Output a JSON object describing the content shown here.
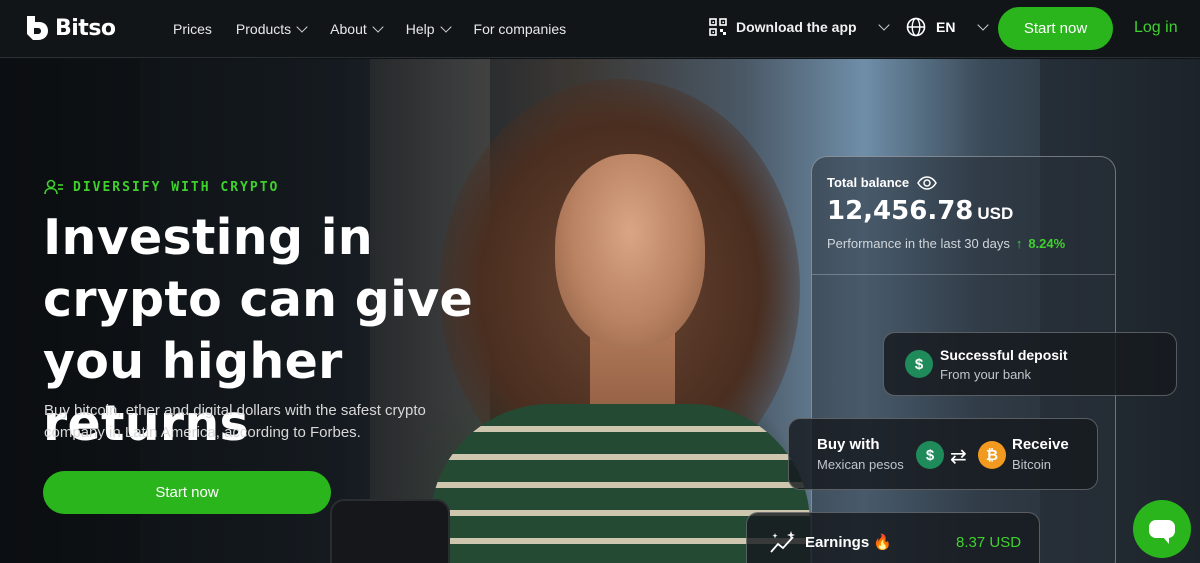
{
  "brand": {
    "name": "Bitso"
  },
  "nav": {
    "items": [
      {
        "label": "Prices",
        "dropdown": false
      },
      {
        "label": "Products",
        "dropdown": true
      },
      {
        "label": "About",
        "dropdown": true
      },
      {
        "label": "Help",
        "dropdown": true
      },
      {
        "label": "For companies",
        "dropdown": false
      }
    ],
    "download_label": "Download the app",
    "language": "EN",
    "start_label": "Start now",
    "login_label": "Log in"
  },
  "hero": {
    "eyebrow": "DIVERSIFY WITH CRYPTO",
    "headline": "Investing in crypto can give you higher returns",
    "subtitle": "Buy bitcoin, ether and digital dollars with the safest crypto company in Latin America, according to Forbes.",
    "cta_label": "Start now"
  },
  "balance_card": {
    "label": "Total balance",
    "amount": "12,456.78",
    "currency": "USD",
    "performance_text": "Performance in the last 30 days",
    "performance_value": "8.24%"
  },
  "deposit_card": {
    "title": "Successful deposit",
    "subtitle": "From your bank"
  },
  "buy_card": {
    "buy_title": "Buy with",
    "buy_subtitle": "Mexican pesos",
    "receive_title": "Receive",
    "receive_subtitle": "Bitcoin"
  },
  "earnings_card": {
    "title": "Earnings",
    "value": "8.37 USD"
  },
  "colors": {
    "accent": "#2ab51c",
    "positive": "#3fd12d",
    "btc": "#f29a1f"
  }
}
